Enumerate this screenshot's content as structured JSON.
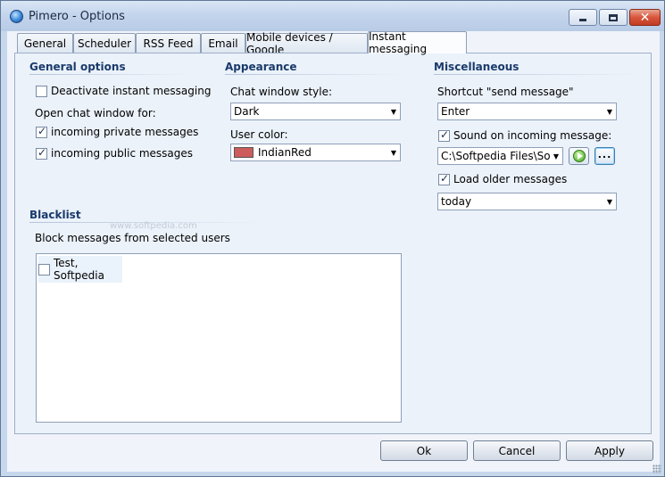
{
  "window": {
    "title": "Pimero - Options",
    "close_glyph": "✕"
  },
  "tabs": [
    {
      "label": "General"
    },
    {
      "label": "Scheduler"
    },
    {
      "label": "RSS Feed"
    },
    {
      "label": "Email"
    },
    {
      "label": "Mobile devices / Google"
    },
    {
      "label": "Instant messaging",
      "active": true
    }
  ],
  "general_options": {
    "heading": "General options",
    "deactivate_label": "Deactivate instant messaging",
    "deactivate_checked": false,
    "open_chat_label": "Open chat window for:",
    "private_label": "incoming private messages",
    "private_checked": true,
    "public_label": "incoming public messages",
    "public_checked": true
  },
  "appearance": {
    "heading": "Appearance",
    "chat_style_label": "Chat window style:",
    "chat_style_value": "Dark",
    "user_color_label": "User color:",
    "user_color_value": "IndianRed",
    "user_color_hex": "#cd5c5c"
  },
  "miscellaneous": {
    "heading": "Miscellaneous",
    "shortcut_label": "Shortcut \"send message\"",
    "shortcut_value": "Enter",
    "sound_label": "Sound on incoming message:",
    "sound_checked": true,
    "sound_file_value": "C:\\Softpedia Files\\Sof...",
    "browse_label": "...",
    "load_older_label": "Load older messages",
    "load_older_checked": true,
    "load_older_value": "today"
  },
  "blacklist": {
    "heading": "Blacklist",
    "description": "Block messages from selected users",
    "users": [
      {
        "name": "Test, Softpedia",
        "checked": false
      }
    ]
  },
  "watermark": "www.softpedia.com",
  "buttons": {
    "ok": "Ok",
    "cancel": "Cancel",
    "apply": "Apply"
  },
  "colors": {
    "accent_heading": "#1a3a6b",
    "panel_bg": "#ebf2fa",
    "frame": "#c7d7ec"
  }
}
